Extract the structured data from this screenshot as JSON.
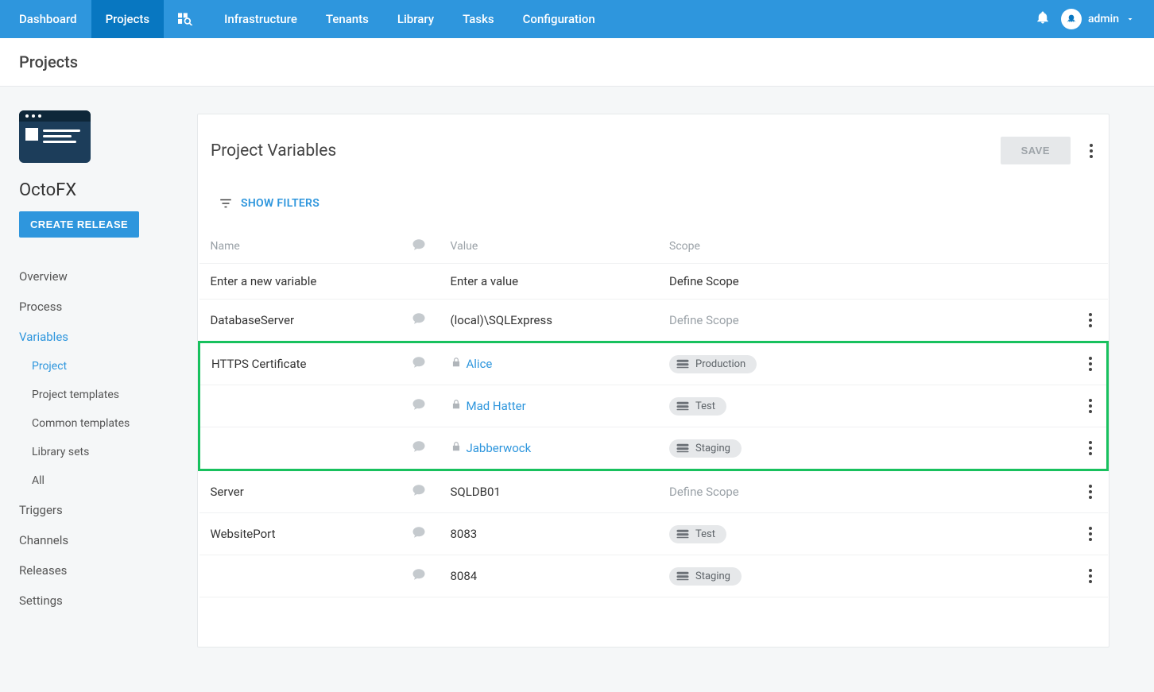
{
  "nav": {
    "items": [
      "Dashboard",
      "Projects",
      "Infrastructure",
      "Tenants",
      "Library",
      "Tasks",
      "Configuration"
    ],
    "active_index": 1,
    "user": "admin"
  },
  "subheader": "Projects",
  "sidebar": {
    "project_name": "OctoFX",
    "create_release_label": "CREATE RELEASE",
    "items": [
      {
        "label": "Overview",
        "sub": false,
        "active": false
      },
      {
        "label": "Process",
        "sub": false,
        "active": false
      },
      {
        "label": "Variables",
        "sub": false,
        "active": true
      },
      {
        "label": "Project",
        "sub": true,
        "active": true
      },
      {
        "label": "Project templates",
        "sub": true,
        "active": false
      },
      {
        "label": "Common templates",
        "sub": true,
        "active": false
      },
      {
        "label": "Library sets",
        "sub": true,
        "active": false
      },
      {
        "label": "All",
        "sub": true,
        "active": false
      },
      {
        "label": "Triggers",
        "sub": false,
        "active": false
      },
      {
        "label": "Channels",
        "sub": false,
        "active": false
      },
      {
        "label": "Releases",
        "sub": false,
        "active": false
      },
      {
        "label": "Settings",
        "sub": false,
        "active": false
      }
    ]
  },
  "panel": {
    "title": "Project Variables",
    "save_label": "SAVE",
    "show_filters": "SHOW FILTERS",
    "columns": {
      "name": "Name",
      "value": "Value",
      "scope": "Scope"
    },
    "placeholders": {
      "name": "Enter a new variable",
      "value": "Enter a value",
      "scope": "Define Scope"
    },
    "rows": [
      {
        "name": "DatabaseServer",
        "value": "(local)\\SQLExpress",
        "link": false,
        "lock": false,
        "scope_placeholder": true,
        "scope": "",
        "highlight": false
      },
      {
        "name": "HTTPS Certificate",
        "value": "Alice",
        "link": true,
        "lock": true,
        "scope_placeholder": false,
        "scope": "Production",
        "highlight": true
      },
      {
        "name": "",
        "value": "Mad Hatter",
        "link": true,
        "lock": true,
        "scope_placeholder": false,
        "scope": "Test",
        "highlight": true
      },
      {
        "name": "",
        "value": "Jabberwock",
        "link": true,
        "lock": true,
        "scope_placeholder": false,
        "scope": "Staging",
        "highlight": true
      },
      {
        "name": "Server",
        "value": "SQLDB01",
        "link": false,
        "lock": false,
        "scope_placeholder": true,
        "scope": "",
        "highlight": false
      },
      {
        "name": "WebsitePort",
        "value": "8083",
        "link": false,
        "lock": false,
        "scope_placeholder": false,
        "scope": "Test",
        "highlight": false
      },
      {
        "name": "",
        "value": "8084",
        "link": false,
        "lock": false,
        "scope_placeholder": false,
        "scope": "Staging",
        "highlight": false
      }
    ]
  }
}
